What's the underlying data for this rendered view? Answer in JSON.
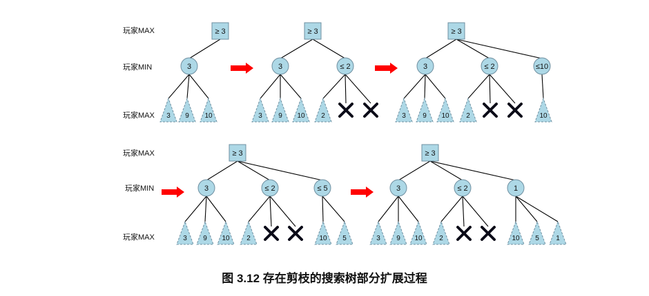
{
  "labels": {
    "max": "玩家MAX",
    "min": "玩家MIN"
  },
  "caption": "图 3.12 存在剪枝的搜索树部分扩展过程",
  "colors": {
    "node_fill": "#add8e6",
    "arrow": "#ff0000",
    "cross": "#0b0b18"
  },
  "panels": [
    {
      "root": "≥ 3",
      "mins": [
        {
          "value": "3",
          "leaves": [
            "3",
            "9",
            "10"
          ]
        }
      ]
    },
    {
      "root": "≥ 3",
      "mins": [
        {
          "value": "3",
          "leaves": [
            "3",
            "9",
            "10"
          ]
        },
        {
          "value": "≤ 2",
          "leaves": [
            "2",
            "pruned",
            "pruned"
          ]
        }
      ]
    },
    {
      "root": "≥ 3",
      "mins": [
        {
          "value": "3",
          "leaves": [
            "3",
            "9",
            "10"
          ]
        },
        {
          "value": "≤ 2",
          "leaves": [
            "2",
            "pruned",
            "pruned"
          ]
        },
        {
          "value": "≤10",
          "leaves": [
            "10"
          ]
        }
      ]
    },
    {
      "root": "≥ 3",
      "mins": [
        {
          "value": "3",
          "leaves": [
            "3",
            "9",
            "10"
          ]
        },
        {
          "value": "≤ 2",
          "leaves": [
            "2",
            "pruned",
            "pruned"
          ]
        },
        {
          "value": "≤ 5",
          "leaves": [
            "10",
            "5"
          ]
        }
      ]
    },
    {
      "root": "≥ 3",
      "mins": [
        {
          "value": "3",
          "leaves": [
            "3",
            "9",
            "10"
          ]
        },
        {
          "value": "≤ 2",
          "leaves": [
            "2",
            "pruned",
            "pruned"
          ]
        },
        {
          "value": "1",
          "leaves": [
            "10",
            "5",
            "1"
          ]
        }
      ]
    }
  ]
}
